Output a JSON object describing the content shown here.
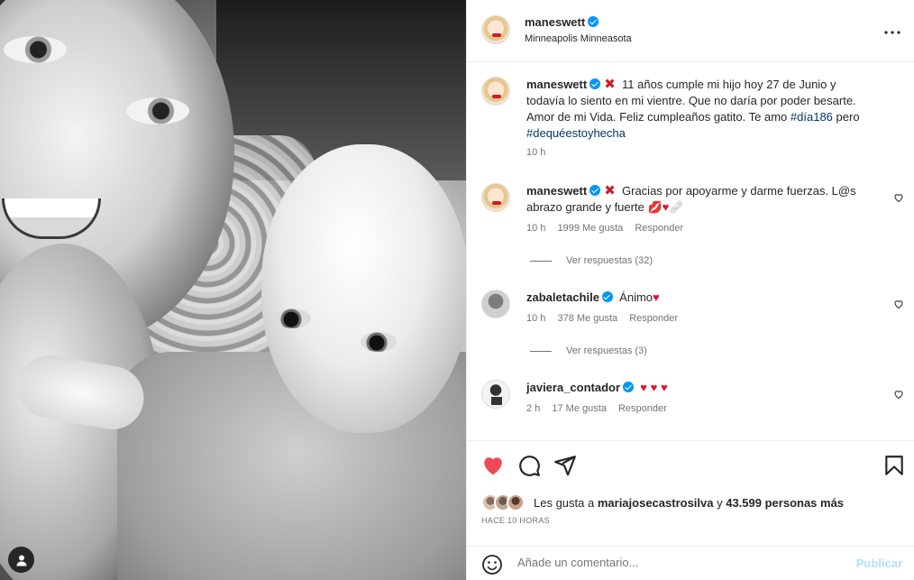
{
  "post": {
    "author": "maneswett",
    "location": "Minneapolis Minneasota",
    "caption_text": "11 años cumple mi hijo hoy 27 de Junio y todavía lo siento en mi vientre. Que no daría por poder besarte. Amor de mi Vida. Feliz cumpleaños gatito. Te amo",
    "hashtag1": "#día186",
    "caption_mid": "pero",
    "hashtag2": "#dequéestoyhecha",
    "caption_time": "10 h"
  },
  "comments": [
    {
      "user": "maneswett",
      "text": "Gracias por apoyarme y darme fuerzas. L@s abrazo grande y fuerte",
      "time": "10 h",
      "likes": "1999 Me gusta",
      "reply": "Responder",
      "view_replies": "Ver respuestas (32)"
    },
    {
      "user": "zabaletachile",
      "text": "Ánimo",
      "time": "10 h",
      "likes": "378 Me gusta",
      "reply": "Responder",
      "view_replies": "Ver respuestas (3)"
    },
    {
      "user": "javiera_contador",
      "text": "",
      "time": "2 h",
      "likes": "17 Me gusta",
      "reply": "Responder"
    }
  ],
  "likes": {
    "prefix": "Les gusta a",
    "user": "mariajosecastrosilva",
    "conj": "y",
    "others": "43.599 personas más"
  },
  "post_time": "HACE 10 HORAS",
  "add_comment": {
    "placeholder": "Añade un comentario...",
    "publish": "Publicar"
  },
  "colors": {
    "like_red": "#ed4956",
    "verified_blue": "#0095f6",
    "hashtag": "#00376b"
  },
  "icons": [
    "more-icon",
    "heart-filled-icon",
    "comment-icon",
    "share-icon",
    "bookmark-icon",
    "emoji-icon",
    "user-tag-icon"
  ]
}
